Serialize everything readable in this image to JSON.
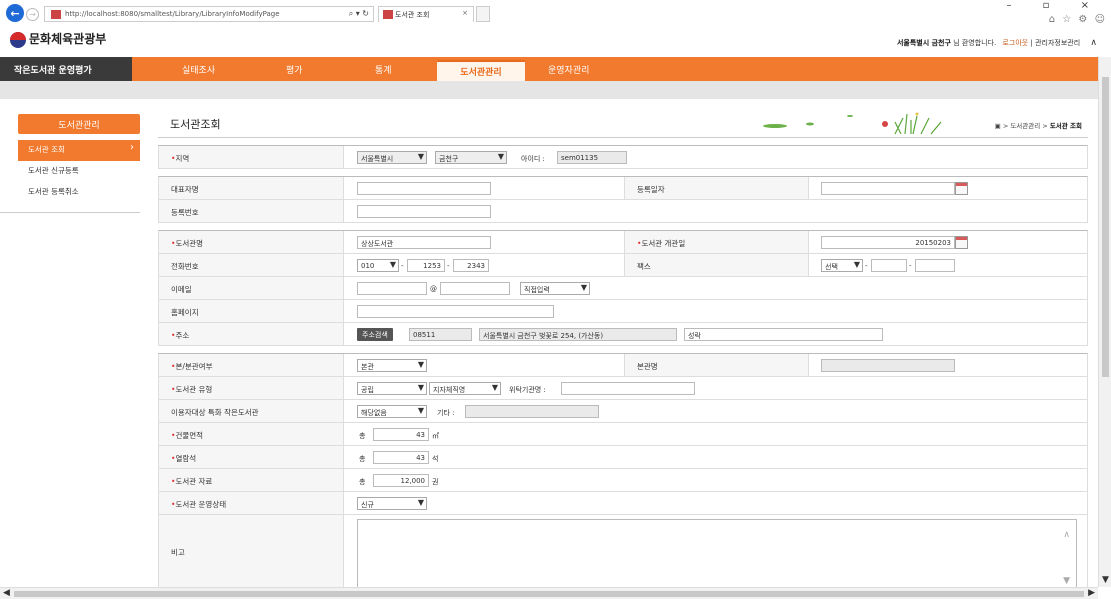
{
  "browser": {
    "url": "http://localhost:8080/smalltest/Library/LibraryInfoModifyPage",
    "addr_controls": "⌕ ▾ ↻",
    "tab_title": "도서관 조회",
    "tab_close": "×",
    "window_controls": "– ▫ ×",
    "tools": "⌂ ☆ ⚙ ☺"
  },
  "header": {
    "logo_text": "문화체육관광부",
    "user_name": "서울특별시 금천구",
    "user_greeting": "님 환영합니다.",
    "logout": "로그아웃",
    "separator": "|",
    "manage_link": "관리자정보관리"
  },
  "nav": {
    "brand": "작은도서관 운영평가",
    "items": [
      "실태조사",
      "평가",
      "통계",
      "도서관관리",
      "운영자관리"
    ]
  },
  "sidebar": {
    "title": "도서관관리",
    "items": [
      "도서관 조회",
      "도서관 신규등록",
      "도서관 등록취소"
    ]
  },
  "page": {
    "title": "도서관조회",
    "breadcrumb_home": "▣ > 도서관관리 >",
    "breadcrumb_current": "도서관 조회"
  },
  "form": {
    "region": {
      "label": "지역",
      "sido": "서울특별시",
      "gu": "금천구",
      "id_label": "아이디 :",
      "id_value": "sem01135"
    },
    "rep_name": {
      "label": "대표자명",
      "value": ""
    },
    "reg_date": {
      "label": "등록일자",
      "value": ""
    },
    "reg_no": {
      "label": "등록번호",
      "value": ""
    },
    "lib_name": {
      "label": "도서관명",
      "value": "상상도서관"
    },
    "open_date": {
      "label": "도서관 개관일",
      "value": "20150203"
    },
    "phone": {
      "label": "전화번호",
      "area": "010",
      "mid": "1253",
      "last": "2343"
    },
    "fax": {
      "label": "팩스",
      "area": "선택",
      "mid": "",
      "last": ""
    },
    "email": {
      "label": "이메일",
      "id": "",
      "at": "@",
      "domain": "",
      "select": "직접입력"
    },
    "homepage": {
      "label": "홈페이지",
      "value": ""
    },
    "address": {
      "label": "주소",
      "search_btn": "주소검색",
      "zip": "08511",
      "road": "서울특별시 금천구 벚꽃로 254, (가산동)",
      "detail": "성락"
    },
    "branch": {
      "label": "본/분관여부",
      "value": "본관",
      "main_label": "본관명",
      "main_value": ""
    },
    "lib_type": {
      "label": "도서관 유형",
      "type": "공립",
      "subtype": "지자체직영",
      "trust_label": "위탁기관명 :",
      "trust_value": ""
    },
    "target": {
      "label": "이용자대상 특화 작은도서관",
      "value": "해당없음",
      "etc_label": "기타 :",
      "etc_value": ""
    },
    "area": {
      "label": "건물면적",
      "prefix": "총",
      "value": "43",
      "unit": "㎡"
    },
    "seats": {
      "label": "열람석",
      "prefix": "총",
      "value": "43",
      "unit": "석"
    },
    "books": {
      "label": "도서관 자료",
      "prefix": "총",
      "value": "12,000",
      "unit": "권"
    },
    "status": {
      "label": "도서관 운영상태",
      "value": "신규"
    },
    "note": {
      "label": "비고"
    }
  },
  "glyphs": {
    "required": "•",
    "dropdown": "▼",
    "dash": "-",
    "scroll_up": "▲",
    "scroll_down": "▼",
    "scroll_left": "◀",
    "scroll_right": "▶",
    "side_arrow": "›",
    "page_up": "∧"
  },
  "colors": {
    "accent": "#f27a2e",
    "brand_bg": "#3a3a3a",
    "required": "#e03232"
  }
}
